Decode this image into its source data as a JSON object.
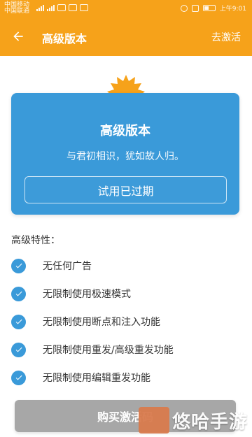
{
  "status_bar": {
    "left_text": [
      "中国移动",
      "中国联通"
    ],
    "right_text": "上午9:01"
  },
  "app_bar": {
    "title": "高级版本",
    "action": "去激活"
  },
  "card": {
    "title": "高级版本",
    "subtitle": "与君初相识，犹如故人归。",
    "trial_button": "试用已过期"
  },
  "features": {
    "heading": "高级特性：",
    "items": [
      "无任何广告",
      "无限制使用极速模式",
      "无限制使用断点和注入功能",
      "无限制使用重发/高级重发功能",
      "无限制使用编辑重发功能"
    ]
  },
  "buy": {
    "label": "购买激活码"
  },
  "watermark": {
    "text": "悠哈手游"
  },
  "colors": {
    "header_orange": "#f6a21a",
    "card_blue": "#3a9ad9",
    "check_blue": "#3a9ad9",
    "buy_gray": "#a7a7a7"
  }
}
